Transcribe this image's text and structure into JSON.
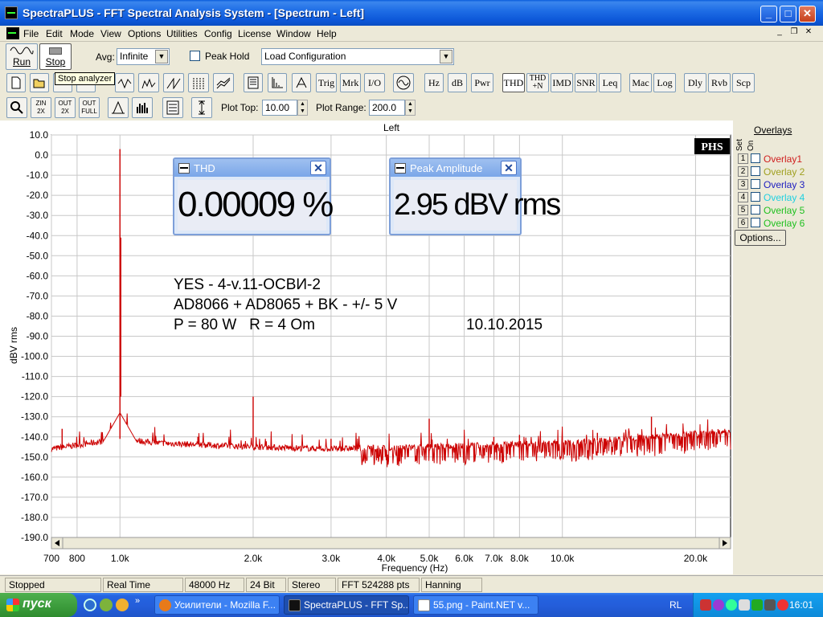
{
  "window": {
    "title": "SpectraPLUS - FFT Spectral Analysis System - [Spectrum - Left]",
    "min": "_",
    "max": "□",
    "close": "✕"
  },
  "menu": [
    "File",
    "Edit",
    "Mode",
    "View",
    "Options",
    "Utilities",
    "Config",
    "License",
    "Window",
    "Help"
  ],
  "mdi": {
    "min": "_",
    "restore": "❐",
    "close": "✕"
  },
  "toolbar1": {
    "run_label": "Run",
    "stop_label": "Stop",
    "avg_label": "Avg:",
    "avg_value": "Infinite",
    "peak_hold_label": "Peak Hold",
    "config_value": "Load Configuration"
  },
  "tooltip": "Stop analyzer",
  "toolbar2": {
    "text_buttons": [
      "Trig",
      "Mrk",
      "I/O",
      "Hz",
      "dB",
      "Pwr",
      "THD",
      "THD +N",
      "IMD",
      "SNR",
      "Leq",
      "Mac",
      "Log",
      "Dly",
      "Rvb",
      "Scp"
    ]
  },
  "toolbar3": {
    "plot_top_label": "Plot Top:",
    "plot_top_value": "10.00",
    "plot_range_label": "Plot Range:",
    "plot_range_value": "200.0",
    "zoom_labels": [
      "ZIN 2X",
      "OUT 2X",
      "OUT FULL"
    ]
  },
  "plot": {
    "title": "Left",
    "logo": "PHS",
    "ylabel": "dBV rms",
    "xlabel": "Frequency (Hz)",
    "trace_color": "#cc0000",
    "grid_color": "#c8c8c8"
  },
  "chart_data": {
    "type": "line",
    "title": "Left",
    "xlabel": "Frequency (Hz)",
    "ylabel": "dBV rms",
    "x_scale": "log",
    "xlim": [
      700,
      24000
    ],
    "ylim": [
      -190,
      10
    ],
    "y_ticks": [
      "10.0",
      "0.0",
      "-10.0",
      "-20.0",
      "-30.0",
      "-40.0",
      "-50.0",
      "-60.0",
      "-70.0",
      "-80.0",
      "-90.0",
      "-100.0",
      "-110.0",
      "-120.0",
      "-130.0",
      "-140.0",
      "-150.0",
      "-160.0",
      "-170.0",
      "-180.0",
      "-190.0"
    ],
    "x_ticks": [
      {
        "v": 700,
        "t": "700"
      },
      {
        "v": 800,
        "t": "800"
      },
      {
        "v": 1000,
        "t": "1.0k"
      },
      {
        "v": 2000,
        "t": "2.0k"
      },
      {
        "v": 3000,
        "t": "3.0k"
      },
      {
        "v": 4000,
        "t": "4.0k"
      },
      {
        "v": 5000,
        "t": "5.0k"
      },
      {
        "v": 6000,
        "t": "6.0k"
      },
      {
        "v": 7000,
        "t": "7.0k"
      },
      {
        "v": 8000,
        "t": "8.0k"
      },
      {
        "v": 10000,
        "t": "10.0k"
      },
      {
        "v": 20000,
        "t": "20.0k"
      }
    ],
    "grid": true,
    "noise_floor": [
      [
        700,
        -146
      ],
      [
        1000,
        -141
      ],
      [
        1200,
        -143
      ],
      [
        2000,
        -145
      ],
      [
        3000,
        -146
      ],
      [
        5000,
        -145
      ],
      [
        10000,
        -143
      ],
      [
        16000,
        -140
      ],
      [
        24000,
        -137
      ]
    ],
    "peaks": [
      {
        "x": 740,
        "y": -136
      },
      {
        "x": 1000,
        "y": 2.95
      },
      {
        "x": 1500,
        "y": -140
      },
      {
        "x": 2000,
        "y": -120
      },
      {
        "x": 3000,
        "y": -141
      },
      {
        "x": 5000,
        "y": -131
      },
      {
        "x": 7000,
        "y": -140
      },
      {
        "x": 8000,
        "y": -139
      },
      {
        "x": 12000,
        "y": -138
      },
      {
        "x": 15900,
        "y": -130
      },
      {
        "x": 22000,
        "y": -145
      }
    ]
  },
  "meters": {
    "thd": {
      "title": "THD",
      "value": "0.00009 %"
    },
    "peak": {
      "title": "Peak Amplitude",
      "value": "2.95 dBV rms"
    }
  },
  "annotation": {
    "line1": "YES - 4-v.11-ОСВИ-2",
    "line2": "AD8066 + AD8065 + BK - +/- 5 V",
    "line3": "P = 80 W   R = 4 Om",
    "date": "10.10.2015"
  },
  "overlays": {
    "header": "Overlays",
    "set_label": "Set",
    "on_label": "On",
    "items": [
      {
        "num": "1",
        "name": "Overlay1",
        "color": "#d02020"
      },
      {
        "num": "2",
        "name": "Overlay 2",
        "color": "#a0a020"
      },
      {
        "num": "3",
        "name": "Overlay 3",
        "color": "#2020c0"
      },
      {
        "num": "4",
        "name": "Overlay 4",
        "color": "#20d0e0"
      },
      {
        "num": "5",
        "name": "Overlay 5",
        "color": "#20c020"
      },
      {
        "num": "6",
        "name": "Overlay 6",
        "color": "#20c020"
      }
    ],
    "options_label": "Options..."
  },
  "status": [
    "Stopped",
    "Real Time",
    "48000 Hz",
    "24 Bit",
    "Stereo",
    "FFT 524288 pts",
    "Hanning"
  ],
  "taskbar": {
    "start": "пуск",
    "tasks": [
      {
        "label": "Усилители - Mozilla F...",
        "icon_color": "#e87a1a"
      },
      {
        "label": "SpectraPLUS - FFT Sp...",
        "icon_color": "#111111"
      },
      {
        "label": "55.png - Paint.NET v...",
        "icon_color": "#ffffff"
      }
    ],
    "lang": "RL",
    "clock": "16:01"
  }
}
